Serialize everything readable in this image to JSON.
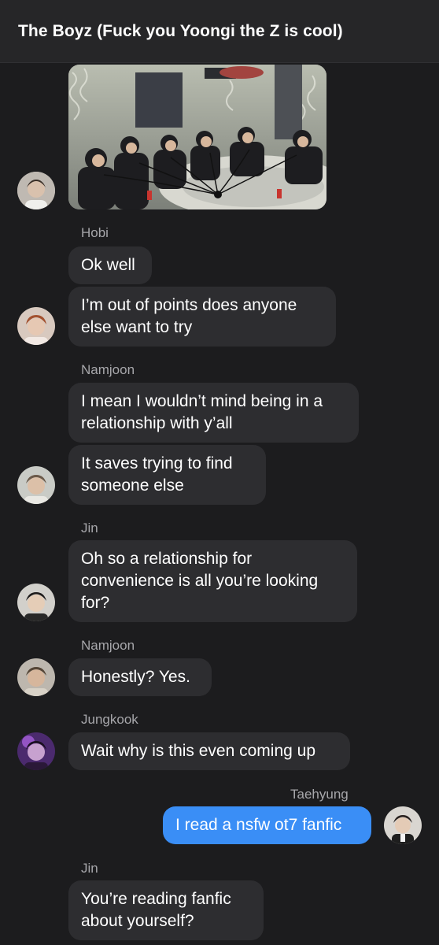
{
  "header": {
    "title": "The Boyz (Fuck you Yoongi the Z is cool)"
  },
  "colors": {
    "background": "#1c1c1e",
    "bubble_incoming": "#2d2d30",
    "bubble_outgoing": "#3a8ef6",
    "sender_name": "#a7a7ab"
  },
  "messages": [
    {
      "sender": "Hobi",
      "text": "Ok well"
    },
    {
      "text": "I’m out of points does anyone else want to try"
    },
    {
      "sender": "Namjoon",
      "text": "I mean I wouldn’t mind being in a relationship with y’all"
    },
    {
      "text": "It saves trying to find someone else"
    },
    {
      "sender": "Jin",
      "text": "Oh so a relationship for convenience is all you’re looking for?"
    },
    {
      "sender": "Namjoon",
      "text": "Honestly? Yes."
    },
    {
      "sender": "Jungkook",
      "text": "Wait why is this even coming up"
    },
    {
      "sender": "Taehyung",
      "text": "I read a nsfw ot7 fanfic"
    },
    {
      "sender": "Jin",
      "text": "You’re reading fanfic about yourself?"
    }
  ]
}
